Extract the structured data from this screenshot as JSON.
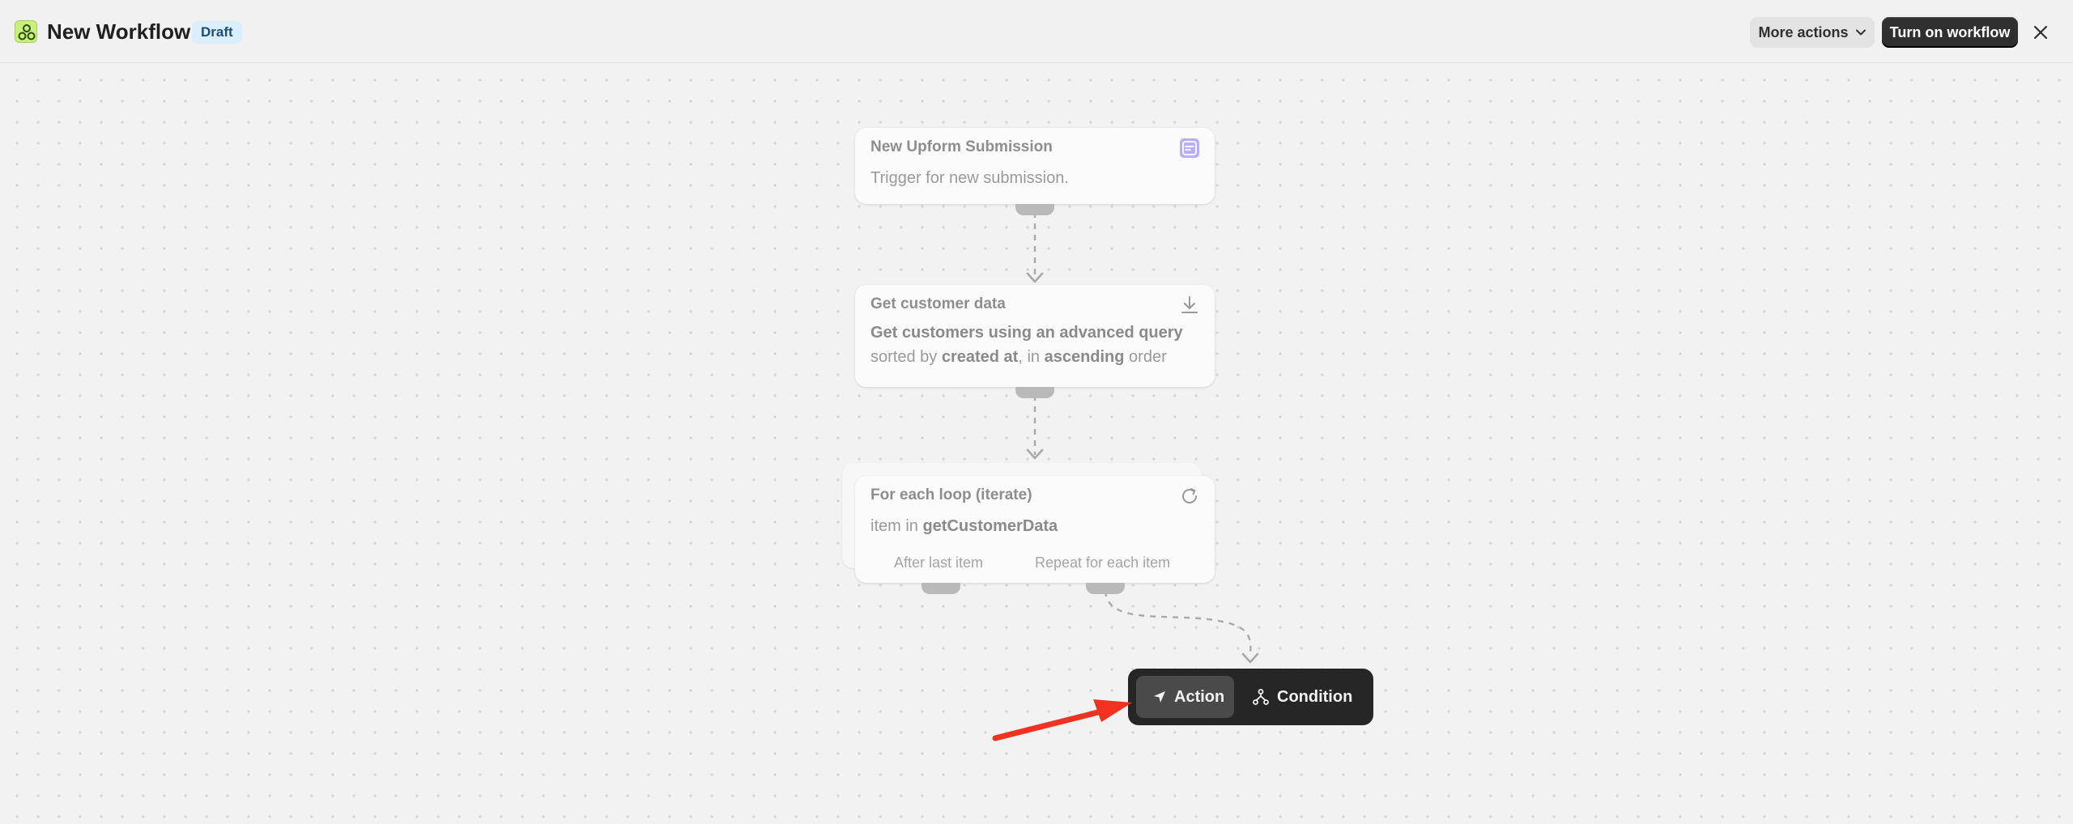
{
  "header": {
    "title": "New Workflow",
    "status_badge": "Draft",
    "more_actions_label": "More actions",
    "turn_on_label": "Turn on workflow",
    "icons": {
      "logo": "workflow-logo-icon",
      "dropdown": "chevron-down-icon",
      "close": "close-icon"
    }
  },
  "nodes": {
    "trigger": {
      "title": "New Upform Submission",
      "body": "Trigger for new submission.",
      "icon": "form-icon",
      "icon_color": "#9b8cf5"
    },
    "get_customers": {
      "title": "Get customer data",
      "line1": "Get customers using an advanced query",
      "line2_pre": "sorted by ",
      "line2_field": "created at",
      "line2_mid": ", in ",
      "line2_order": "ascending",
      "line2_post": " order",
      "icon": "download-icon"
    },
    "loop": {
      "title": "For each loop (iterate)",
      "body_pre": "item in ",
      "body_var": "getCustomerData",
      "branch_after": "After last item",
      "branch_repeat": "Repeat for each item",
      "icon": "refresh-icon"
    }
  },
  "add_step_popup": {
    "action_label": "Action",
    "condition_label": "Condition",
    "icons": {
      "action": "send-arrow-icon",
      "condition": "branch-icon"
    }
  },
  "annotation": {
    "arrow_color": "#f0321e"
  }
}
